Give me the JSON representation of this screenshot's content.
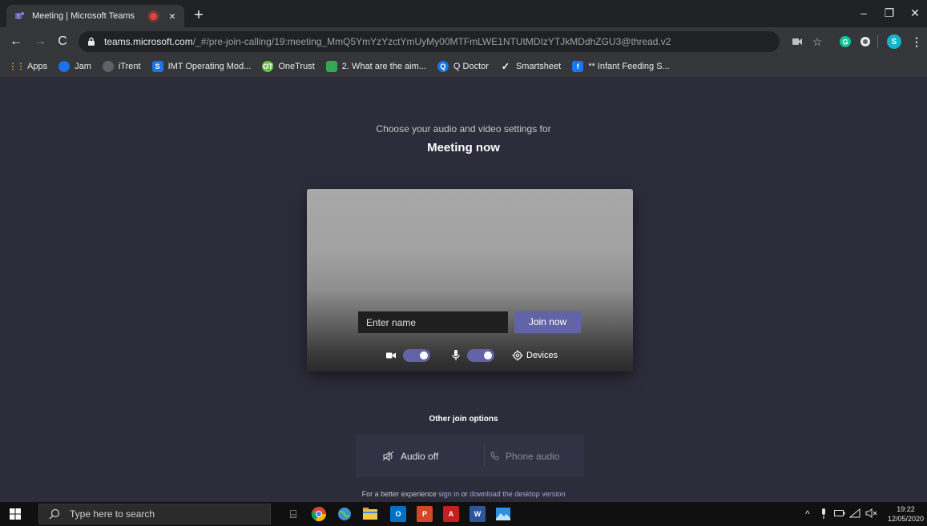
{
  "browser": {
    "tab_title": "Meeting | Microsoft Teams",
    "tab_close": "×",
    "new_tab": "+",
    "url_host": "teams.microsoft.com",
    "url_path": "/_#/pre-join-calling/19:meeting_MmQ5YmYzYzctYmUyMy00MTFmLWE1NTUtMDIzYTJkMDdhZGU3@thread.v2",
    "profile_initial": "S",
    "window_controls": [
      "–",
      "❐",
      "✕"
    ]
  },
  "bookmarks": [
    {
      "label": "Apps",
      "icon": "apps-grid-icon",
      "color": "#f4b400"
    },
    {
      "label": "Jam",
      "icon": "jam-icon",
      "color": "#1a73e8"
    },
    {
      "label": "iTrent",
      "icon": "globe-icon",
      "color": "#5f6368"
    },
    {
      "label": "IMT Operating Mod...",
      "icon": "sharepoint-icon",
      "color": "#1a73e8"
    },
    {
      "label": "OneTrust",
      "icon": "onetrust-icon",
      "color": "#6cc04a"
    },
    {
      "label": "2. What are the aim...",
      "icon": "image-icon",
      "color": "#34a853"
    },
    {
      "label": "Q Doctor",
      "icon": "qdoctor-icon",
      "color": "#1a73e8"
    },
    {
      "label": "Smartsheet",
      "icon": "check-icon",
      "color": "#ffffff"
    },
    {
      "label": "** Infant Feeding S...",
      "icon": "facebook-icon",
      "color": "#1877f2"
    }
  ],
  "prejoin": {
    "subtitle": "Choose your audio and video settings for",
    "meeting_title": "Meeting now",
    "name_placeholder": "Enter name",
    "join_label": "Join now",
    "camera_on": true,
    "mic_on": true,
    "devices_label": "Devices"
  },
  "other_options": {
    "title": "Other join options",
    "audio_off": "Audio off",
    "phone_audio": "Phone audio",
    "footer_prefix": "For a better experience ",
    "sign_in": "sign in",
    "or": " or ",
    "download": "download the desktop version"
  },
  "taskbar": {
    "search_placeholder": "Type here to search",
    "time": "19:22",
    "date": "12/05/2020"
  },
  "colors": {
    "accent": "#6264a7",
    "background": "#2d2c3b",
    "link": "#a6a7dc"
  }
}
